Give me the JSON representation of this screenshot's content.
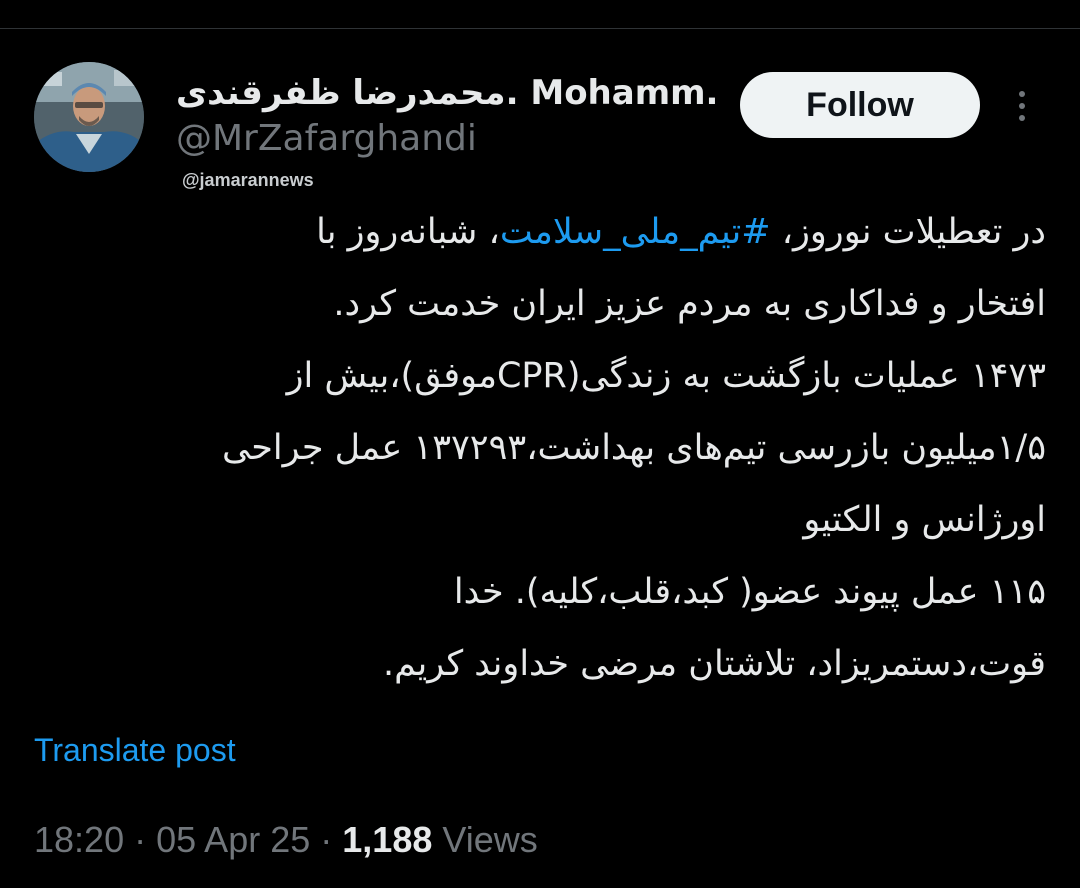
{
  "author": {
    "display_name": "محمدرضا ظفرقندی. Mohamm...",
    "handle": "@MrZafarghandi"
  },
  "follow_label": "Follow",
  "watermark": "@jamarannews",
  "tweet": {
    "lines": [
      {
        "before": "در تعطیلات نوروز، ",
        "hashtag": "#تیم_ملی_سلامت",
        "after": "، شبانه‌روز با"
      },
      {
        "text": "افتخار و فداکاری به مردم عزیز ایران خدمت کرد."
      },
      {
        "text": "۱۴۷۳ عملیات بازگشت به زندگی(CPRموفق)،بیش از"
      },
      {
        "text": "۱/۵میلیون بازرسی تیم‌های بهداشت،۱۳۷۲۹۳ عمل جراحی"
      },
      {
        "text": "اورژانس و الکتیو"
      },
      {
        "text": "۱۱۵ عمل پیوند عضو( کبد،قلب،کلیه). خدا"
      },
      {
        "text": "قوت،دستمریزاد، تلاشتان مرضی خداوند کریم."
      }
    ]
  },
  "translate_label": "Translate post",
  "meta": {
    "time": "18:20",
    "date": "05 Apr 25",
    "views_count": "1,188",
    "views_label": "Views",
    "separator": "·"
  },
  "colors": {
    "background": "#000000",
    "text": "#e7e9ea",
    "muted": "#71767b",
    "link": "#1d9bf0",
    "follow_bg": "#eff3f4"
  }
}
